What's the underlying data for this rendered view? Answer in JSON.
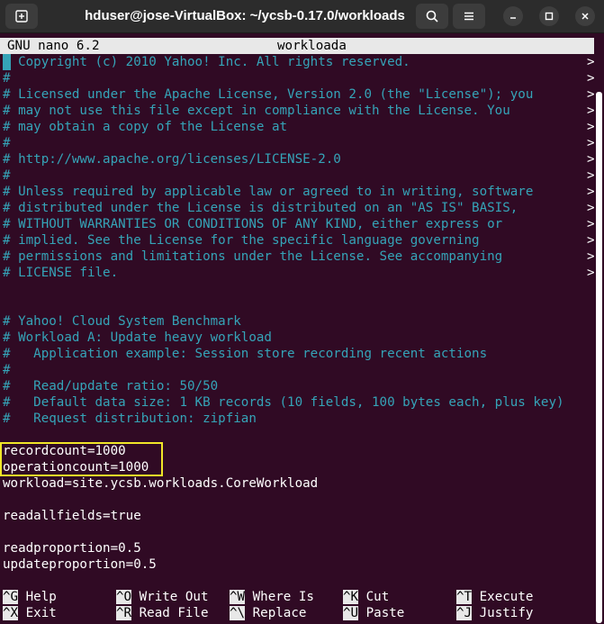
{
  "window": {
    "title": "hduser@jose-VirtualBox: ~/ycsb-0.17.0/workloads",
    "buttons": {
      "new_tab": "new-tab-icon",
      "search": "search-icon",
      "menu": "hamburger-icon",
      "minimize": "minimize-icon",
      "maximize": "maximize-icon",
      "close": "close-icon"
    }
  },
  "nano": {
    "version": "GNU nano 6.2",
    "filename": "workloada",
    "lines": [
      {
        "text": "# Copyright (c) 2010 Yahoo! Inc. All rights reserved.",
        "type": "comment",
        "truncated": true
      },
      {
        "text": "#",
        "type": "comment",
        "truncated": true
      },
      {
        "text": "# Licensed under the Apache License, Version 2.0 (the \"License\"); you",
        "type": "comment",
        "truncated": true
      },
      {
        "text": "# may not use this file except in compliance with the License. You",
        "type": "comment",
        "truncated": true
      },
      {
        "text": "# may obtain a copy of the License at",
        "type": "comment",
        "truncated": true
      },
      {
        "text": "#",
        "type": "comment",
        "truncated": true
      },
      {
        "text": "# http://www.apache.org/licenses/LICENSE-2.0",
        "type": "comment",
        "truncated": true
      },
      {
        "text": "#",
        "type": "comment",
        "truncated": true
      },
      {
        "text": "# Unless required by applicable law or agreed to in writing, software",
        "type": "comment",
        "truncated": true
      },
      {
        "text": "# distributed under the License is distributed on an \"AS IS\" BASIS,",
        "type": "comment",
        "truncated": true
      },
      {
        "text": "# WITHOUT WARRANTIES OR CONDITIONS OF ANY KIND, either express or",
        "type": "comment",
        "truncated": true
      },
      {
        "text": "# implied. See the License for the specific language governing",
        "type": "comment",
        "truncated": true
      },
      {
        "text": "# permissions and limitations under the License. See accompanying",
        "type": "comment",
        "truncated": true
      },
      {
        "text": "# LICENSE file.",
        "type": "comment",
        "truncated": true
      },
      {
        "text": "",
        "type": "normal",
        "truncated": false
      },
      {
        "text": "",
        "type": "normal",
        "truncated": false
      },
      {
        "text": "# Yahoo! Cloud System Benchmark",
        "type": "comment",
        "truncated": false
      },
      {
        "text": "# Workload A: Update heavy workload",
        "type": "comment",
        "truncated": false
      },
      {
        "text": "#   Application example: Session store recording recent actions",
        "type": "comment",
        "truncated": false
      },
      {
        "text": "#",
        "type": "comment",
        "truncated": false
      },
      {
        "text": "#   Read/update ratio: 50/50",
        "type": "comment",
        "truncated": false
      },
      {
        "text": "#   Default data size: 1 KB records (10 fields, 100 bytes each, plus key)",
        "type": "comment",
        "truncated": false
      },
      {
        "text": "#   Request distribution: zipfian",
        "type": "comment",
        "truncated": false
      },
      {
        "text": "",
        "type": "normal",
        "truncated": false
      },
      {
        "text": "recordcount=1000",
        "type": "normal",
        "truncated": false
      },
      {
        "text": "operationcount=1000",
        "type": "normal",
        "truncated": false
      },
      {
        "text": "workload=site.ycsb.workloads.CoreWorkload",
        "type": "normal",
        "truncated": false
      },
      {
        "text": "",
        "type": "normal",
        "truncated": false
      },
      {
        "text": "readallfields=true",
        "type": "normal",
        "truncated": false
      },
      {
        "text": "",
        "type": "normal",
        "truncated": false
      },
      {
        "text": "readproportion=0.5",
        "type": "normal",
        "truncated": false
      },
      {
        "text": "updateproportion=0.5",
        "type": "normal",
        "truncated": false
      }
    ],
    "truncation_marker": ">",
    "shortcuts_row1": [
      {
        "key": "^G",
        "label": "Help"
      },
      {
        "key": "^O",
        "label": "Write Out"
      },
      {
        "key": "^W",
        "label": "Where Is"
      },
      {
        "key": "^K",
        "label": "Cut"
      },
      {
        "key": "^T",
        "label": "Execute"
      }
    ],
    "shortcuts_row2": [
      {
        "key": "^X",
        "label": "Exit"
      },
      {
        "key": "^R",
        "label": "Read File"
      },
      {
        "key": "^\\",
        "label": "Replace"
      },
      {
        "key": "^U",
        "label": "Paste"
      },
      {
        "key": "^J",
        "label": "Justify"
      }
    ]
  },
  "colors": {
    "background": "#300a24",
    "comment": "#35a4b8",
    "highlight_box": "#f0e628"
  }
}
